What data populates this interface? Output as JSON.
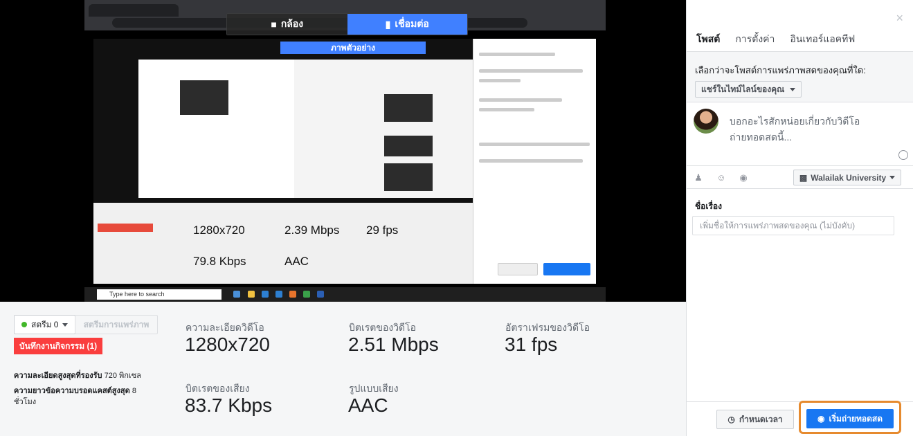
{
  "colors": {
    "accent": "#1877f2",
    "mode_active": "#4080ff",
    "log_red": "#fa3e3e",
    "live_green": "#42b72a",
    "highlight": "#e68a2e"
  },
  "mode_bar": {
    "camera": "กล้อง",
    "connect": "เชื่อมต่อ"
  },
  "preview": {
    "title": "ภาพตัวอย่าง",
    "taskbar_search": "Type here to search"
  },
  "stats": {
    "stream_label": "สตรีม 0",
    "stream_button": "สตรีมการแพร่ภาพ",
    "log_button": "บันทึกงานกิจกรรม (1)",
    "max_res_label": "ความละเอียดสูงสุดที่รองรับ",
    "max_res_value": "720 พิกเซล",
    "max_len_label": "ความยาวข้อความบรอดแคสต์สูงสุด",
    "max_len_value": "8",
    "max_len_unit": "ชั่วโมง",
    "video_res_label": "ความละเอียดวิดีโอ",
    "video_res": "1280x720",
    "bitrate_label": "บิตเรตของวิดีโอ",
    "bitrate": "2.51 Mbps",
    "framerate_label": "อัตราเฟรมของวิดีโอ",
    "framerate": "31 fps",
    "audio_bitrate_label": "บิตเรตของเสียง",
    "audio_bitrate": "83.7 Kbps",
    "audio_format_label": "รูปแบบเสียง",
    "audio_format": "AAC"
  },
  "inner": {
    "res": "1280x720",
    "bitrate": "2.39 Mbps",
    "fps": "29 fps",
    "audio_bitrate": "79.8 Kbps",
    "audio_format": "AAC"
  },
  "panel": {
    "tabs": [
      "โพสต์",
      "การตั้งค่า",
      "อินเทอร์แอคทีฟ"
    ],
    "question": "เลือกว่าจะโพสต์การแพร่ภาพสดของคุณที่ใด:",
    "destination": "แชร์ในไทม์ไลน์ของคุณ",
    "composer_placeholder": "บอกอะไรสักหน่อยเกี่ยวกับวิดีโอถ่ายทอดสดนี้...",
    "audience": "Walailak University",
    "title_label": "ชื่อเรื่อง",
    "title_placeholder": "เพิ่มชื่อให้การแพร่ภาพสดของคุณ (ไม่บังคับ)",
    "schedule_button": "กำหนดเวลา",
    "golive_button": "เริ่มถ่ายทอดสด"
  },
  "icons": {
    "close": "close-icon",
    "camera": "camera-icon",
    "connect": "connect-icon",
    "tag_people": "tag-people-icon",
    "feeling": "feeling-icon",
    "location": "location-icon",
    "emoji": "emoji-icon",
    "clock": "clock-icon",
    "live": "live-icon"
  }
}
